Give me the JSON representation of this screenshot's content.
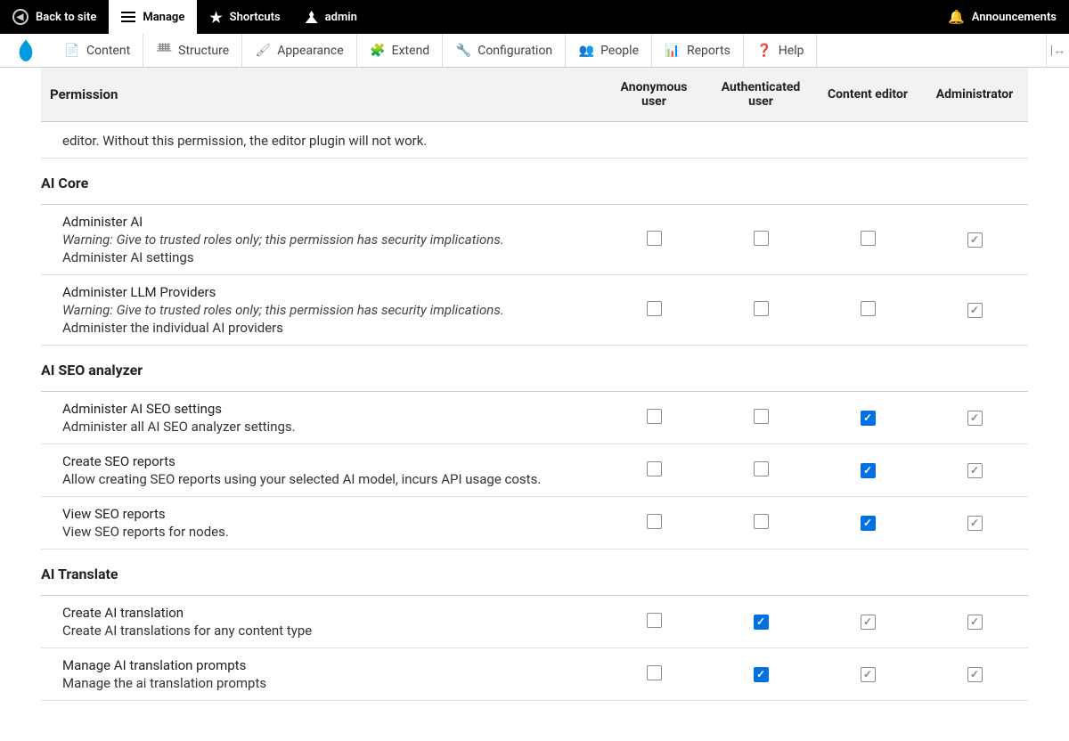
{
  "toolbar": {
    "back": "Back to site",
    "manage": "Manage",
    "shortcuts": "Shortcuts",
    "admin": "admin",
    "announcements": "Announcements"
  },
  "adminmenu": {
    "content": "Content",
    "structure": "Structure",
    "appearance": "Appearance",
    "extend": "Extend",
    "configuration": "Configuration",
    "people": "People",
    "reports": "Reports",
    "help": "Help"
  },
  "table": {
    "header_permission": "Permission",
    "roles": [
      "Anonymous user",
      "Authenticated user",
      "Content editor",
      "Administrator"
    ],
    "partial_row": {
      "text": "editor. Without this permission, the editor plugin will not work.",
      "checks": []
    },
    "groups": [
      {
        "name": "AI Core",
        "rows": [
          {
            "title": "Administer AI",
            "warning": "Warning: Give to trusted roles only; this permission has security implications.",
            "desc": "Administer AI settings",
            "checks": [
              "",
              "",
              "",
              "gray"
            ]
          },
          {
            "title": "Administer LLM Providers",
            "warning": "Warning: Give to trusted roles only; this permission has security implications.",
            "desc": "Administer the individual AI providers",
            "checks": [
              "",
              "",
              "",
              "gray"
            ]
          }
        ]
      },
      {
        "name": "AI SEO analyzer",
        "rows": [
          {
            "title": "Administer AI SEO settings",
            "desc": "Administer all AI SEO analyzer settings.",
            "checks": [
              "",
              "",
              "blue",
              "gray"
            ]
          },
          {
            "title": "Create SEO reports",
            "desc": "Allow creating SEO reports using your selected AI model, incurs API usage costs.",
            "checks": [
              "",
              "",
              "blue",
              "gray"
            ]
          },
          {
            "title": "View SEO reports",
            "desc": "View SEO reports for nodes.",
            "checks": [
              "",
              "",
              "blue",
              "gray"
            ]
          }
        ]
      },
      {
        "name": "AI Translate",
        "rows": [
          {
            "title": "Create AI translation",
            "desc": "Create AI translations for any content type",
            "checks": [
              "",
              "blue",
              "gray",
              "gray"
            ]
          },
          {
            "title": "Manage AI translation prompts",
            "desc": "Manage the ai translation prompts",
            "checks": [
              "",
              "blue",
              "gray",
              "gray"
            ]
          }
        ]
      }
    ]
  }
}
